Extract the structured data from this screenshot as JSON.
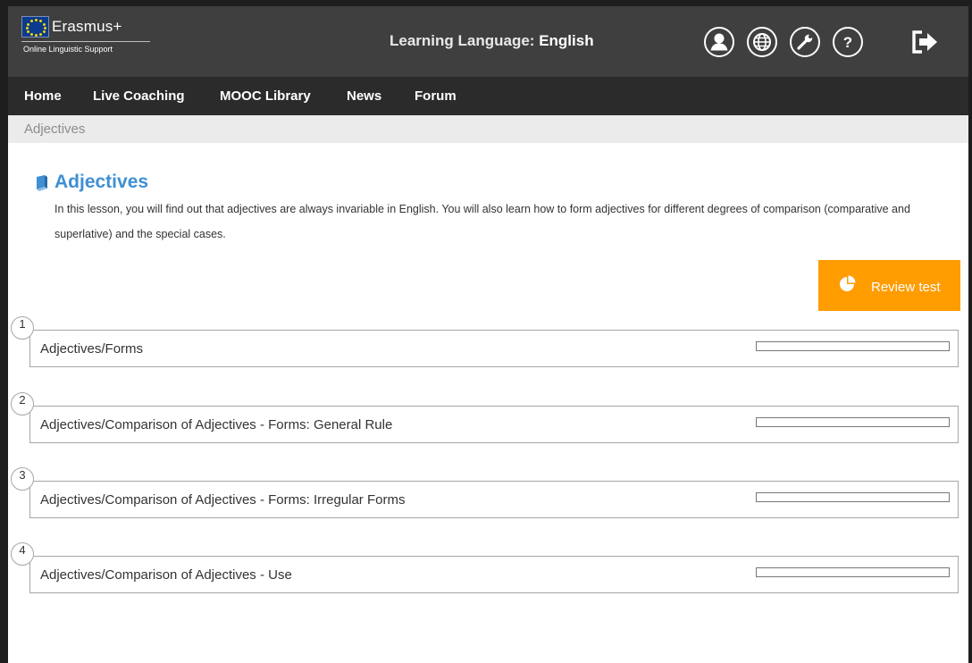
{
  "header": {
    "logo_title": "Erasmus+",
    "logo_subtitle": "Online Linguistic Support",
    "learning_prefix": "Learning Language: ",
    "learning_language": "English",
    "icons": [
      "user-profile-icon",
      "globe-icon",
      "wrench-icon",
      "help-icon",
      "logout-icon"
    ]
  },
  "nav": {
    "items": [
      {
        "label": "Home"
      },
      {
        "label": "Live Coaching"
      },
      {
        "label": "MOOC Library"
      },
      {
        "label": "News"
      },
      {
        "label": "Forum"
      }
    ]
  },
  "breadcrumb": "Adjectives",
  "lesson_page": {
    "title": "Adjectives",
    "intro": "In this lesson, you will find out that adjectives are always invariable in English. You will also learn how to form adjectives for different degrees of comparison (comparative and superlative) and the special cases.",
    "review_button": "Review test"
  },
  "lessons": [
    {
      "number": "1",
      "label": "Adjectives/Forms",
      "progress": 0
    },
    {
      "number": "2",
      "label": "Adjectives/Comparison of Adjectives - Forms: General Rule",
      "progress": 0
    },
    {
      "number": "3",
      "label": "Adjectives/Comparison of Adjectives - Forms: Irregular Forms",
      "progress": 0
    },
    {
      "number": "4",
      "label": "Adjectives/Comparison of Adjectives - Use",
      "progress": 0
    }
  ],
  "colors": {
    "header_bg": "#3f3f3f",
    "nav_bg": "#2b2b2b",
    "accent_blue": "#3f8fd2",
    "review_orange": "#ff9c00"
  }
}
